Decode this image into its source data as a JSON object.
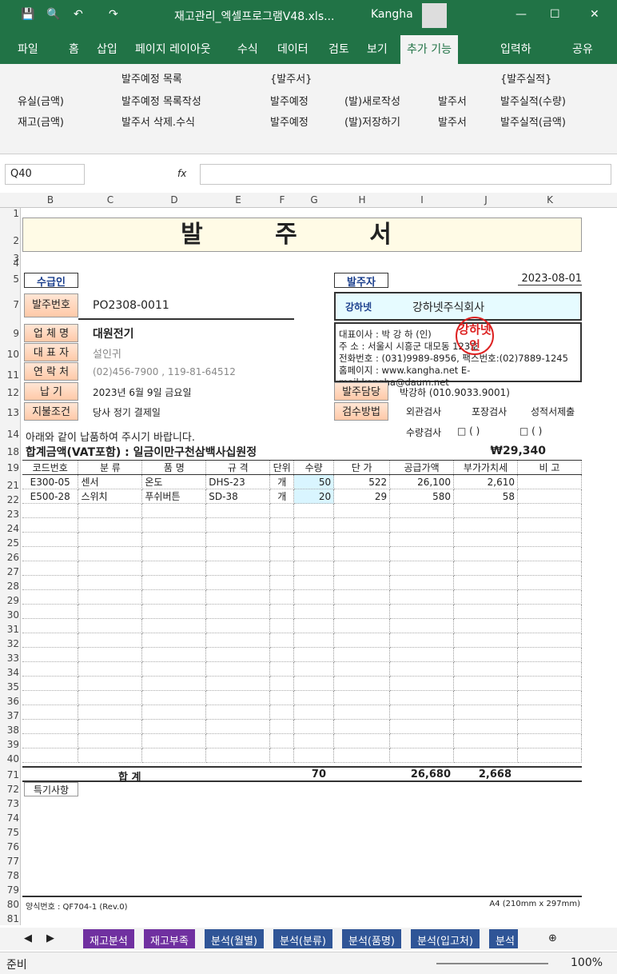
{
  "window": {
    "title": "재고관리_엑셀프로그램V48.xls...",
    "user": "Kangha"
  },
  "tabs": [
    "파일",
    "홈",
    "삽입",
    "페이지 레이아웃",
    "수식",
    "데이터",
    "검토",
    "보기",
    "추가 기능",
    "입력하",
    "공유"
  ],
  "ribbon": {
    "r1": "유실(금액)",
    "r2": "재고(금액)",
    "b1": "발주예정 목록",
    "b2": "발주예정 목록작성",
    "b3": "발주서 삭제.수식",
    "g1": "{발주서}",
    "g1a": "발주예정",
    "g1b": "발주예정",
    "g1c": "(발)새로작성",
    "g1d": "(발)저장하기",
    "g2a": "발주서",
    "g2b": "발주서",
    "g3": "{발주실적}",
    "g3a": "발주실적(수량)",
    "g3b": "발주실적(금액)"
  },
  "namebox": "Q40",
  "fx": "fx",
  "cols": [
    "B",
    "C",
    "D",
    "E",
    "F",
    "G",
    "H",
    "I",
    "J",
    "K"
  ],
  "rows": [
    "1",
    "2",
    "3",
    "4",
    "5",
    "7",
    "9",
    "10",
    "11",
    "12",
    "13",
    "14",
    "18",
    "19",
    "21",
    "22",
    "23",
    "24",
    "25",
    "26",
    "27",
    "28",
    "29",
    "30",
    "31",
    "32",
    "33",
    "34",
    "35",
    "36",
    "37",
    "38",
    "39",
    "40",
    "71",
    "72",
    "73",
    "74",
    "75",
    "76",
    "77",
    "78",
    "79",
    "80",
    "81"
  ],
  "doc": {
    "title": "발 주 서",
    "supplier_label": "수급인",
    "orderer_label": "발주자",
    "date": "2023-08-01",
    "order_no_label": "발주번호",
    "order_no": "PO2308-0011",
    "company_label": "업 체 명",
    "company": "대원전기",
    "ceo_label": "대 표 자",
    "ceo": "설인귀",
    "contact_label": "연 락 처",
    "contact": "(02)456-7900 , 119-81-64512",
    "delivery_label": "납     기",
    "delivery": "2023년 6월 9일 금요일",
    "payment_label": "지불조건",
    "payment": "당사 정기 결제일",
    "notice": "아래와 같이 납품하여 주시기 바랍니다.",
    "total_label": "합계금액(VAT포함) :  일금이만구천삼백사십원정",
    "total": "₩29,340",
    "own_logo": "강하넷",
    "own_name": "강하넷주식회사",
    "own_ceo": "대표이사 : 박  강  하  (인)",
    "own_addr": "주      소 : 서울시 시흥군 대모동 123호",
    "own_tel": "전화번호 : (031)9989-8956, 팩스번호:(02)7889-1245",
    "own_web": "홈페이지 : www.kangha.net  E-mail:kangha@daum.net",
    "seal": "강하넷인",
    "manager_label": "발주담당",
    "manager": "박강하 (010.9033.9001)",
    "inspect_label": "검수방법",
    "i1": "외관검사",
    "i2": "포장검사",
    "i3": "성적서제출",
    "i4": "수량검사",
    "i5": "□ (         )",
    "i6": "□ (         )",
    "headers": [
      "코드번호",
      "분  류",
      "품  명",
      "규  격",
      "단위",
      "수량",
      "단 가",
      "공급가액",
      "부가가치세",
      "비  고"
    ],
    "items": [
      [
        "E300-05",
        "센서",
        "온도",
        "DHS-23",
        "개",
        "50",
        "522",
        "26,100",
        "2,610",
        ""
      ],
      [
        "E500-28",
        "스위치",
        "푸쉬버튼",
        "SD-38",
        "개",
        "20",
        "29",
        "580",
        "58",
        ""
      ]
    ],
    "sum_label": "합           계",
    "sum_qty": "70",
    "sum_supply": "26,680",
    "sum_vat": "2,668",
    "remarks_label": "특기사항",
    "form_no": "양식번호 : QF704-1 (Rev.0)",
    "paper": "A4 (210mm x 297mm)"
  },
  "sheets": [
    "재고분석",
    "재고부족",
    "분석(월별)",
    "분석(분류)",
    "분석(품명)",
    "분석(입고처)",
    "분석"
  ],
  "status": {
    "ready": "준비",
    "zoom": "100%"
  }
}
